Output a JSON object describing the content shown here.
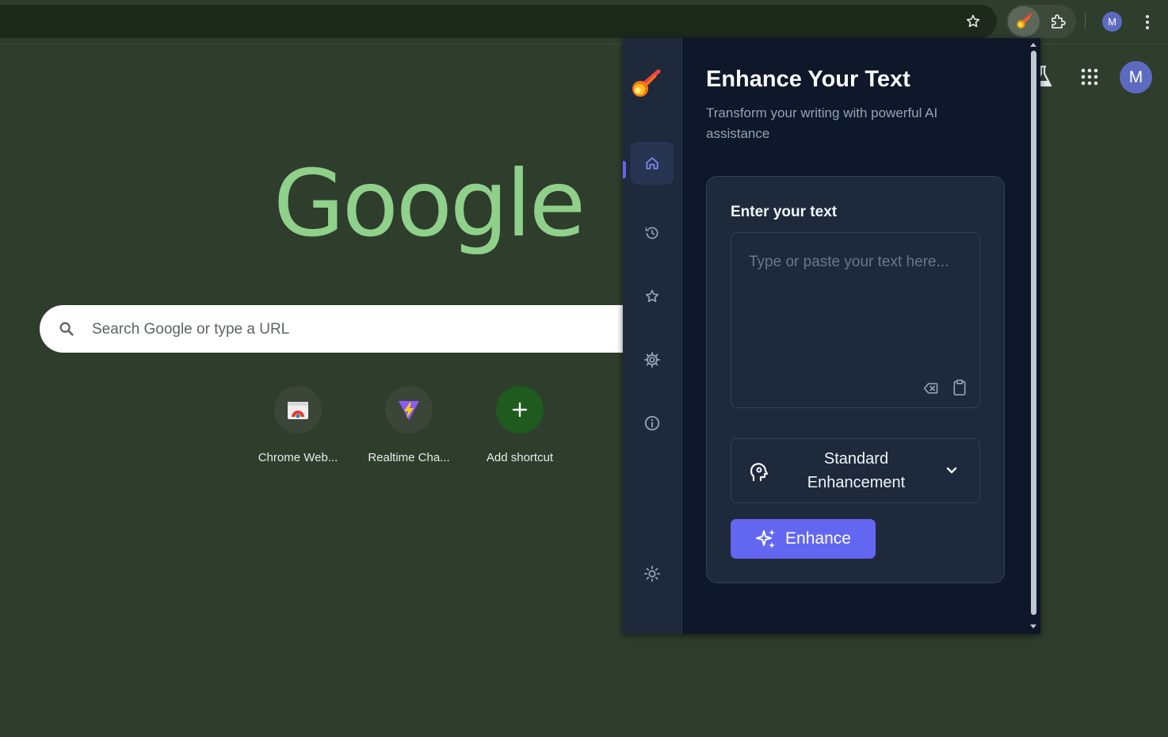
{
  "browser": {
    "profile_initial": "M"
  },
  "newtab": {
    "logo_text": "Google",
    "search_placeholder": "Search Google or type a URL",
    "shortcuts": [
      {
        "label": "Chrome Web..."
      },
      {
        "label": "Realtime Cha..."
      },
      {
        "label": "Add shortcut"
      }
    ],
    "profile_initial": "M"
  },
  "popup": {
    "title": "Enhance Your Text",
    "subtitle": "Transform your writing with powerful AI assistance",
    "input_label": "Enter your text",
    "input_placeholder": "Type or paste your text here...",
    "input_value": "",
    "mode_selected": "Standard Enhancement",
    "enhance_label": "Enhance",
    "nav": [
      "home-icon",
      "history-icon",
      "star-icon",
      "gear-icon",
      "info-icon",
      "sun-icon"
    ],
    "active_nav": "home-icon",
    "colors": {
      "accent": "#6366f1",
      "panel_bg": "#0f172a",
      "card_bg": "#1e293b"
    }
  }
}
